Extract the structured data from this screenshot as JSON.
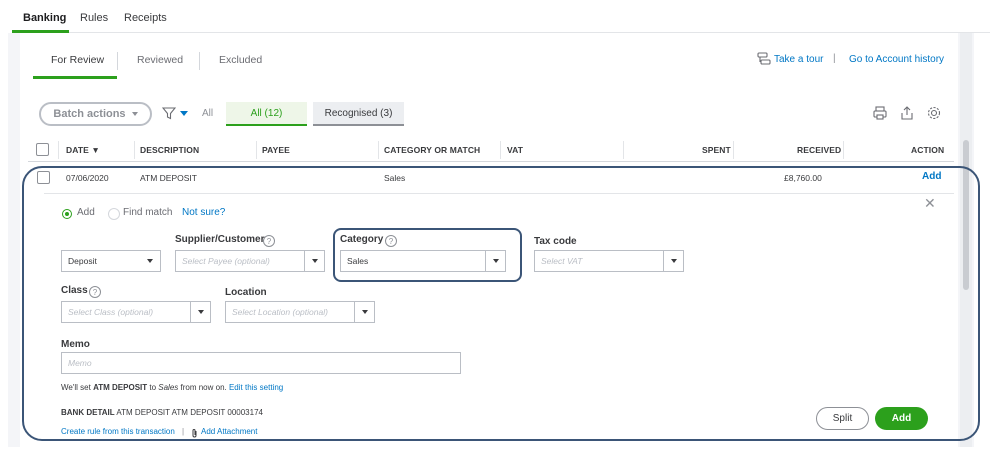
{
  "top_tabs": [
    {
      "label": "Banking",
      "active": true
    },
    {
      "label": "Rules",
      "active": false
    },
    {
      "label": "Receipts",
      "active": false
    }
  ],
  "sub_tabs": [
    {
      "label": "For Review",
      "active": true
    },
    {
      "label": "Reviewed",
      "active": false
    },
    {
      "label": "Excluded",
      "active": false
    }
  ],
  "links": {
    "take_tour": "Take a tour",
    "separator": "|",
    "account_history": "Go to Account history"
  },
  "filters": {
    "batch_actions": "Batch actions",
    "all_label": "All",
    "pill_all": "All (12)",
    "pill_recognised": "Recognised (3)"
  },
  "table": {
    "headers": {
      "date": "DATE ▼",
      "description": "DESCRIPTION",
      "payee": "PAYEE",
      "category": "CATEGORY OR MATCH",
      "vat": "VAT",
      "spent": "SPENT",
      "received": "RECEIVED",
      "action": "ACTION"
    },
    "row": {
      "date": "07/06/2020",
      "description": "ATM DEPOSIT",
      "category": "Sales",
      "received": "£8,760.00",
      "action": "Add"
    }
  },
  "detail": {
    "close": "✕",
    "radio_add": "Add",
    "radio_find": "Find match",
    "not_sure": "Not sure?",
    "type_value": "Deposit",
    "supplier_label": "Supplier/Customer",
    "supplier_placeholder": "Select Payee (optional)",
    "category_label": "Category",
    "category_value": "Sales",
    "taxcode_label": "Tax code",
    "taxcode_placeholder": "Select VAT",
    "class_label": "Class",
    "class_placeholder": "Select Class (optional)",
    "location_label": "Location",
    "location_placeholder": "Select Location (optional)",
    "memo_label": "Memo",
    "memo_placeholder": "Memo",
    "help_glyph": "?",
    "note_prefix": "We'll set ",
    "note_bold": "ATM DEPOSIT",
    "note_mid": " to ",
    "note_em": "Sales",
    "note_suffix": " from now on. ",
    "note_link": "Edit this setting",
    "bank_detail_label": "BANK DETAIL",
    "bank_detail_value": " ATM DEPOSIT ATM DEPOSIT 00003174",
    "create_rule": "Create rule from this transaction",
    "link_sep": "|",
    "add_attachment": "Add Attachment",
    "split_button": "Split",
    "add_button": "Add"
  },
  "colors": {
    "accent_green": "#2ca01c",
    "link_blue": "#0077c5",
    "highlight_outline": "#3b5577"
  },
  "icons": [
    "tour-icon",
    "filter-icon",
    "print-icon",
    "export-icon",
    "settings-gear-icon",
    "close-icon",
    "help-icon",
    "paperclip-icon",
    "chevron-down-icon"
  ]
}
